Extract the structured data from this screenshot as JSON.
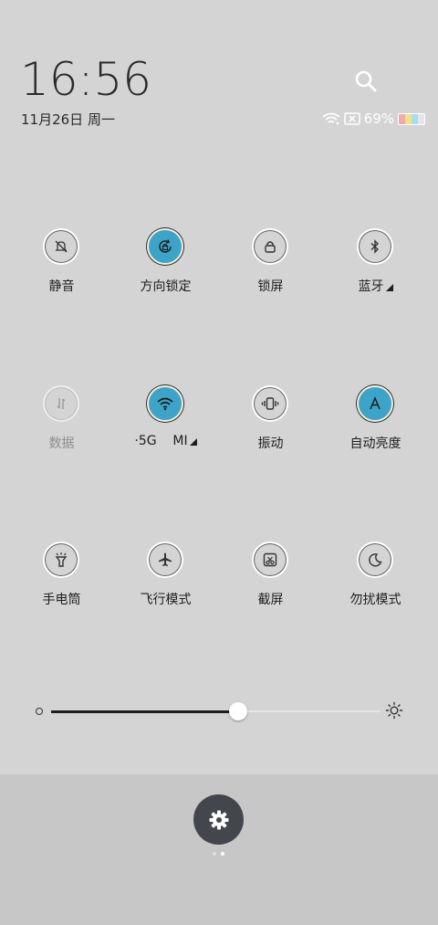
{
  "header": {
    "time": "16:56",
    "date": "11月26日 周一",
    "battery_percent": "69%"
  },
  "tiles": [
    {
      "label": "静音",
      "icon": "silent-bell-icon",
      "state": "off"
    },
    {
      "label": "方向锁定",
      "icon": "rotation-lock-icon",
      "state": "on"
    },
    {
      "label": "锁屏",
      "icon": "lock-icon",
      "state": "off"
    },
    {
      "label": "蓝牙",
      "icon": "bluetooth-icon",
      "state": "off",
      "has_more": true
    },
    {
      "label": "数据",
      "icon": "mobile-data-icon",
      "state": "dim"
    },
    {
      "label": "·5G    MI",
      "icon": "wifi-icon",
      "state": "on",
      "has_more": true
    },
    {
      "label": "振动",
      "icon": "vibrate-icon",
      "state": "off"
    },
    {
      "label": "自动亮度",
      "icon": "auto-brightness-icon",
      "state": "on"
    },
    {
      "label": "手电筒",
      "icon": "flashlight-icon",
      "state": "off"
    },
    {
      "label": "飞行模式",
      "icon": "airplane-icon",
      "state": "off"
    },
    {
      "label": "截屏",
      "icon": "screenshot-icon",
      "state": "off"
    },
    {
      "label": "勿扰模式",
      "icon": "moon-icon",
      "state": "off"
    }
  ],
  "brightness": {
    "level": 0.57
  },
  "colors": {
    "accent": "#3ea3c9",
    "background": "#d3d4d3",
    "footer": "#c6c7c6",
    "settings_button": "#43464d"
  },
  "pager": {
    "pages": 2,
    "active": 1
  }
}
